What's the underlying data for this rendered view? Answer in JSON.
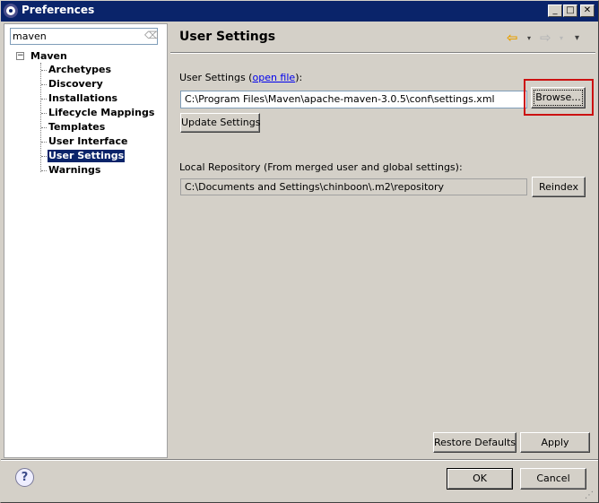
{
  "window": {
    "title": "Preferences",
    "minimize_glyph": "_",
    "maximize_glyph": "□",
    "close_glyph": "✕"
  },
  "filter": {
    "value": "maven",
    "clear_icon": "⌫"
  },
  "tree": {
    "toggle": "−",
    "root": "Maven",
    "items": [
      {
        "label": "Archetypes"
      },
      {
        "label": "Discovery"
      },
      {
        "label": "Installations"
      },
      {
        "label": "Lifecycle Mappings"
      },
      {
        "label": "Templates"
      },
      {
        "label": "User Interface"
      },
      {
        "label": "User Settings",
        "selected": true
      },
      {
        "label": "Warnings"
      }
    ]
  },
  "page": {
    "title": "User Settings",
    "nav_back": "⇦",
    "nav_forward": "⇨",
    "menu_arrow": "▾",
    "user_settings_label_prefix": "User Settings (",
    "open_file_link": "open file",
    "user_settings_label_suffix": "):",
    "settings_path": "C:\\Program Files\\Maven\\apache-maven-3.0.5\\conf\\settings.xml",
    "browse_label": "Browse...",
    "update_label": "Update Settings",
    "local_repo_label": "Local Repository (From merged user and global settings):",
    "local_repo_path": "C:\\Documents and Settings\\chinboon\\.m2\\repository",
    "reindex_label": "Reindex",
    "restore_label": "Restore Defaults",
    "apply_label": "Apply"
  },
  "footer": {
    "help_glyph": "?",
    "ok_label": "OK",
    "cancel_label": "Cancel"
  },
  "colors": {
    "titlebar": "#0a246a",
    "selection": "#0a246a",
    "highlight_box": "#cc1111",
    "link": "#0000ee"
  }
}
